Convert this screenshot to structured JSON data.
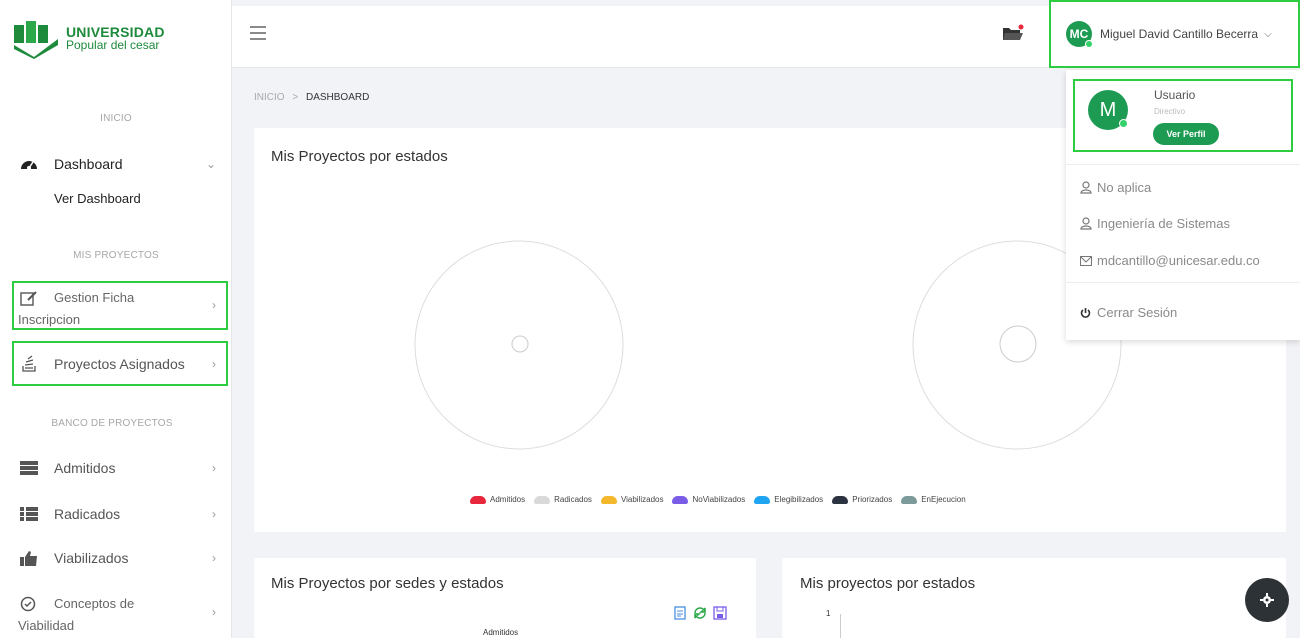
{
  "brand": {
    "line1": "UNIVERSIDAD",
    "line2": "Popular del cesar"
  },
  "sidebar": {
    "section_inicio": "INICIO",
    "dashboard_label": "Dashboard",
    "dashboard_sub": "Ver Dashboard",
    "section_mis_proyectos": "MIS PROYECTOS",
    "gestion_line1": "Gestion Ficha",
    "gestion_line2": "Inscripcion",
    "proyectos_asignados": "Proyectos Asignados",
    "section_banco": "BANCO DE PROYECTOS",
    "admitidos": "Admitidos",
    "radicados": "Radicados",
    "viabilizados": "Viabilizados",
    "conceptos_line1": "Conceptos de",
    "conceptos_line2": "Viabilidad"
  },
  "header": {
    "user_initials": "MC",
    "user_name": "Miguel David Cantillo Becerra"
  },
  "breadcrumb": {
    "home": "INICIO",
    "separator": ">",
    "current": "DASHBOARD"
  },
  "card1": {
    "title": "Mis Proyectos por estados"
  },
  "legend": [
    {
      "label": "Admitidos",
      "color": "#e8263c"
    },
    {
      "label": "Radicados",
      "color": "#d9d9d9"
    },
    {
      "label": "Viabilizados",
      "color": "#f5b72b"
    },
    {
      "label": "NoViabilizados",
      "color": "#7a5ce6"
    },
    {
      "label": "Elegibilizados",
      "color": "#1ea4f0"
    },
    {
      "label": "Priorizados",
      "color": "#2c3340"
    },
    {
      "label": "EnEjecucion",
      "color": "#7c9a9a"
    }
  ],
  "card2": {
    "title": "Mis Proyectos por sedes y estados",
    "chart_label": "Admitidos"
  },
  "card3": {
    "title": "Mis proyectos por estados",
    "y_tick": "1"
  },
  "dropdown": {
    "avatar_letter": "M",
    "role": "Usuario",
    "subrole": "Directivo",
    "profile_button": "Ver Perfil",
    "item1": "No aplica",
    "item2": "Ingeniería de Sistemas",
    "email": "mdcantillo@unicesar.edu.co",
    "logout": "Cerrar Sesión"
  },
  "colors": {
    "accent": "#1e9b52",
    "highlight": "#2ecc40"
  }
}
